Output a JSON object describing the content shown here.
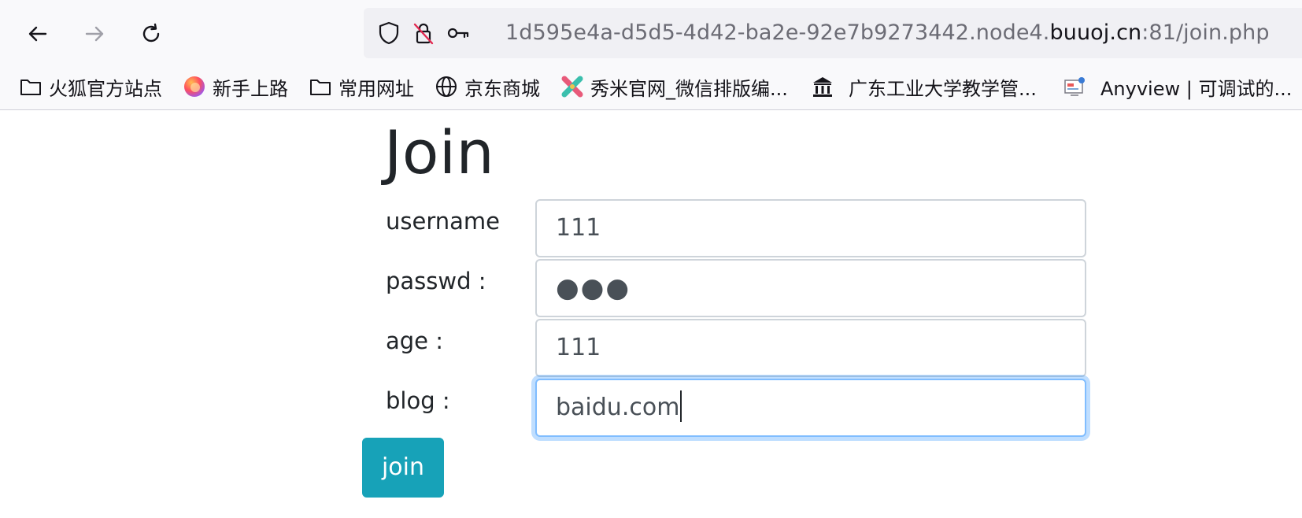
{
  "browser": {
    "url_prefix": "1d595e4a-d5d5-4d42-ba2e-92e7b9273442.node4.",
    "url_host": "buuoj.cn",
    "url_suffix": ":81/join.php",
    "bookmarks": [
      {
        "label": "火狐官方站点",
        "icon": "folder-icon"
      },
      {
        "label": "新手上路",
        "icon": "firefox-icon"
      },
      {
        "label": "常用网址",
        "icon": "folder-icon"
      },
      {
        "label": "京东商城",
        "icon": "globe-icon"
      },
      {
        "label": "秀米官网_微信排版编...",
        "icon": "xiumi-icon"
      },
      {
        "label": "广东工业大学教学管...",
        "icon": "university-icon"
      },
      {
        "label": "Anyview | 可调试的...",
        "icon": "anyview-icon"
      }
    ]
  },
  "form": {
    "title": "Join",
    "username_label": "username",
    "username_value": "111",
    "passwd_label": "passwd :",
    "passwd_value": "●●●",
    "age_label": "age :",
    "age_value": "111",
    "blog_label": "blog :",
    "blog_value": "baidu.com",
    "submit_label": "join"
  },
  "colors": {
    "button": "#17a2b8",
    "focus_ring": "#80bdff",
    "input_border": "#ced4da"
  }
}
